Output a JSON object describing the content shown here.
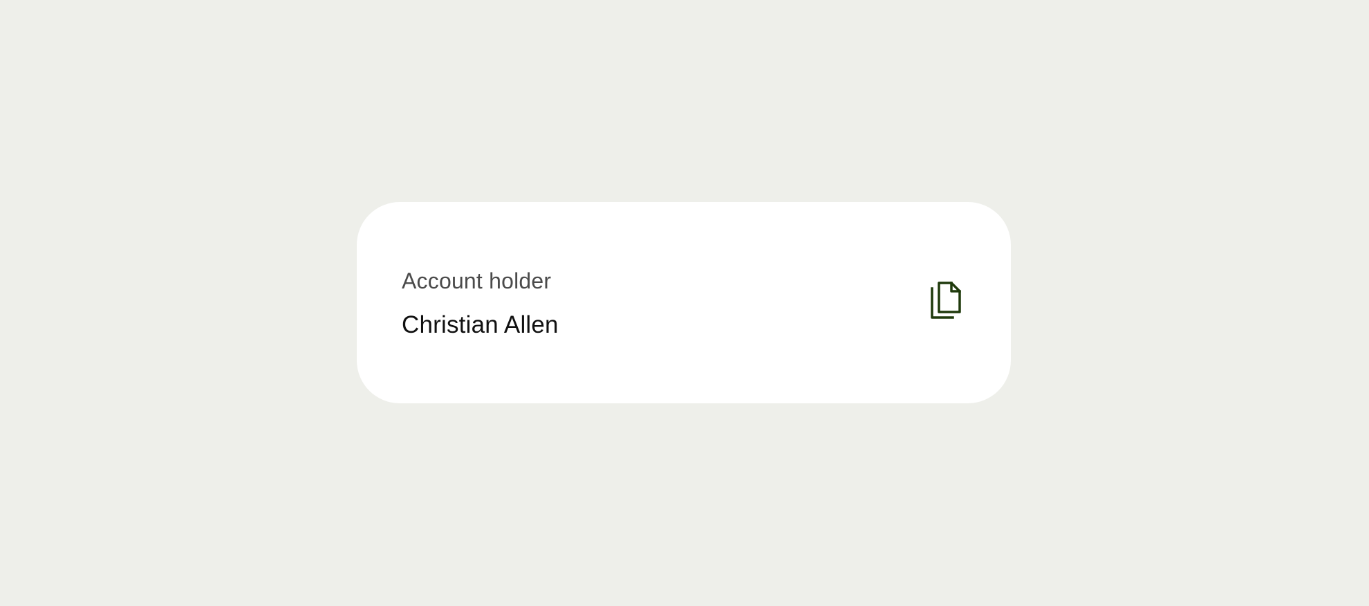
{
  "account": {
    "label": "Account holder",
    "value": "Christian Allen"
  },
  "actions": {
    "copy_icon": "copy-icon"
  },
  "colors": {
    "background": "#eeefea",
    "card": "#ffffff",
    "label_text": "#4b4b4b",
    "value_text": "#111111",
    "icon": "#1f3a0c"
  }
}
